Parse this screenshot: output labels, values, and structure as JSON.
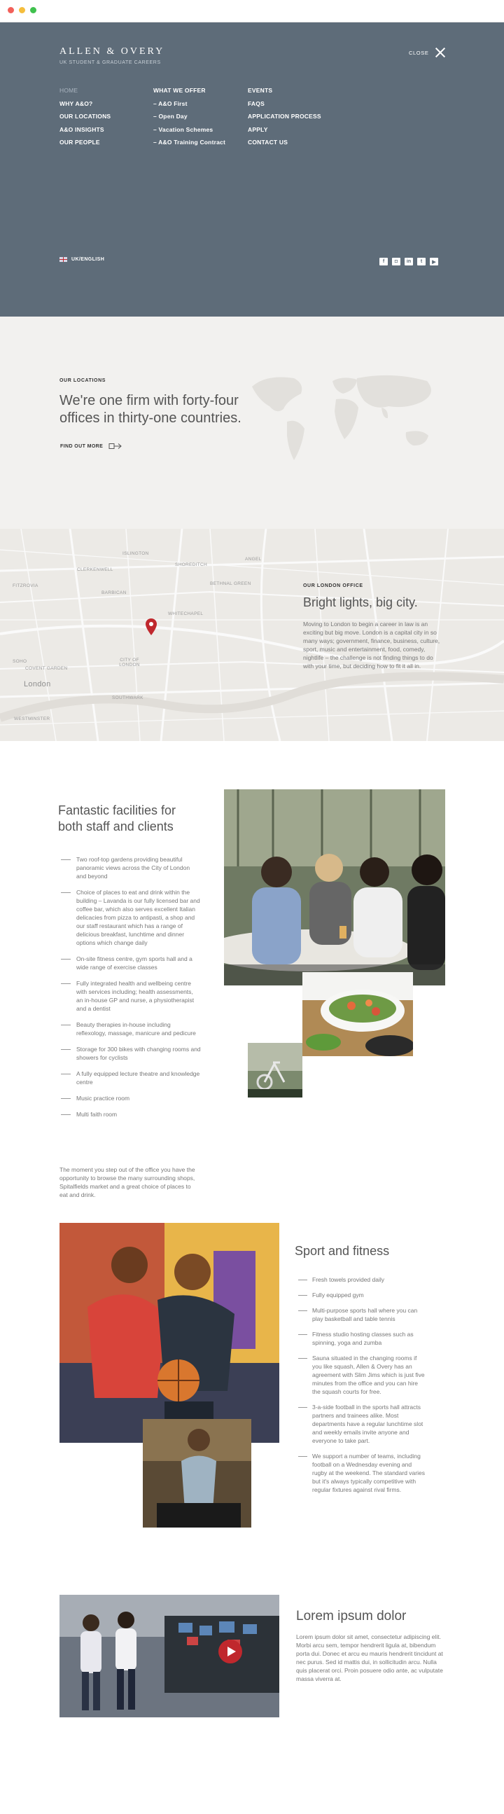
{
  "header": {
    "brand": "ALLEN & OVERY",
    "subtitle": "UK STUDENT & GRADUATE CAREERS",
    "close_label": "CLOSE"
  },
  "nav": {
    "col1": [
      "HOME",
      "WHY A&O?",
      "OUR LOCATIONS",
      "A&O INSIGHTS",
      "OUR PEOPLE"
    ],
    "col2": [
      "WHAT WE OFFER",
      "– A&O First",
      "– Open Day",
      "– Vacation Schemes",
      "– A&O Training Contract"
    ],
    "col3": [
      "EVENTS",
      "FAQS",
      "APPLICATION PROCESS",
      "APPLY",
      "CONTACT US"
    ]
  },
  "language": "UK/ENGLISH",
  "social": {
    "icons": [
      "facebook-icon",
      "instagram-icon",
      "linkedin-icon",
      "twitter-icon",
      "youtube-icon"
    ],
    "glyphs": [
      "f",
      "◘",
      "in",
      "t",
      "▶"
    ]
  },
  "locations": {
    "eyebrow": "OUR LOCATIONS",
    "heading": "We're one firm with forty-four offices in thirty-one countries.",
    "link": "FIND OUT MORE"
  },
  "map": {
    "labels": [
      "London",
      "COVENT GARDEN",
      "CITY OF LONDON",
      "SOHO",
      "FITZROVIA",
      "CLERKENWELL",
      "ISLINGTON",
      "SHOREDITCH",
      "WHITECHAPEL",
      "SOUTHWARK",
      "WESTMINSTER",
      "BARBICAN",
      "ANGEL",
      "BETHNAL GREEN"
    ]
  },
  "london": {
    "eyebrow": "OUR LONDON OFFICE",
    "heading": "Bright lights, big city.",
    "body": "Moving to London to begin a career in law is an exciting but big move. London is a capital city in so many ways; government, finance, business, culture, sport, music and entertainment, food, comedy, nightlife – the challenge is not finding things to do with your time, but deciding how to fit it all in."
  },
  "facilities": {
    "heading": "Fantastic facilities for both staff and clients",
    "items": [
      "Two roof-top gardens providing beautiful panoramic views across the City of London and beyond",
      "Choice of places to eat and drink within the building – Lavanda is our fully licensed bar and coffee bar, which also serves excellent Italian delicacies from pizza to antipasti, a shop and our staff restaurant which has a range of delicious breakfast, lunchtime and dinner options which change daily",
      "On-site fitness centre, gym sports hall and a wide range of exercise classes",
      "Fully integrated health and wellbeing centre with services including; health assessments, an in-house GP and nurse, a physiotherapist and a dentist",
      "Beauty therapies in-house including reflexology, massage, manicure and pedicure",
      "Storage for 300 bikes with changing rooms and showers for cyclists",
      "A fully equipped lecture theatre and knowledge centre",
      "Music practice room",
      "Multi faith room"
    ],
    "outro": "The moment you step out of the office you have the opportunity to browse the many surrounding shops, Spitalfields market and a great choice of places to eat and drink."
  },
  "sport": {
    "heading": "Sport and fitness",
    "items": [
      "Fresh towels provided daily",
      "Fully equipped gym",
      "Multi-purpose sports hall where you can play basketball and table tennis",
      "Fitness studio hosting classes such as spinning, yoga and zumba",
      "Sauna situated in the changing rooms if you like squash, Allen & Overy has an agreement with Slim Jims which is just five minutes from the office and you can hire the squash courts for free.",
      "3-a-side football in the sports hall attracts partners and trainees alike. Most departments have a regular lunchtime slot and weekly emails invite anyone and everyone to take part.",
      "We support a number of teams, including football on a Wednesday evening and rugby at the weekend. The standard varies but it's always typically competitive with regular fixtures against rival firms."
    ]
  },
  "video": {
    "heading": "Lorem ipsum dolor",
    "body": "Lorem ipsum dolor sit amet, consectetur adipiscing elit. Morbi arcu sem, tempor hendrerit ligula at, bibendum porta dui. Donec et arcu eu mauris hendrerit tincidunt at nec purus. Sed id mattis dui, in sollicitudin arcu. Nulla quis placerat orci. Proin posuere odio ante, ac vulputate massa viverra at."
  },
  "colors": {
    "hero_bg": "#5e6c79",
    "light_bg": "#f2f1ef",
    "accent_red": "#c0282d"
  }
}
